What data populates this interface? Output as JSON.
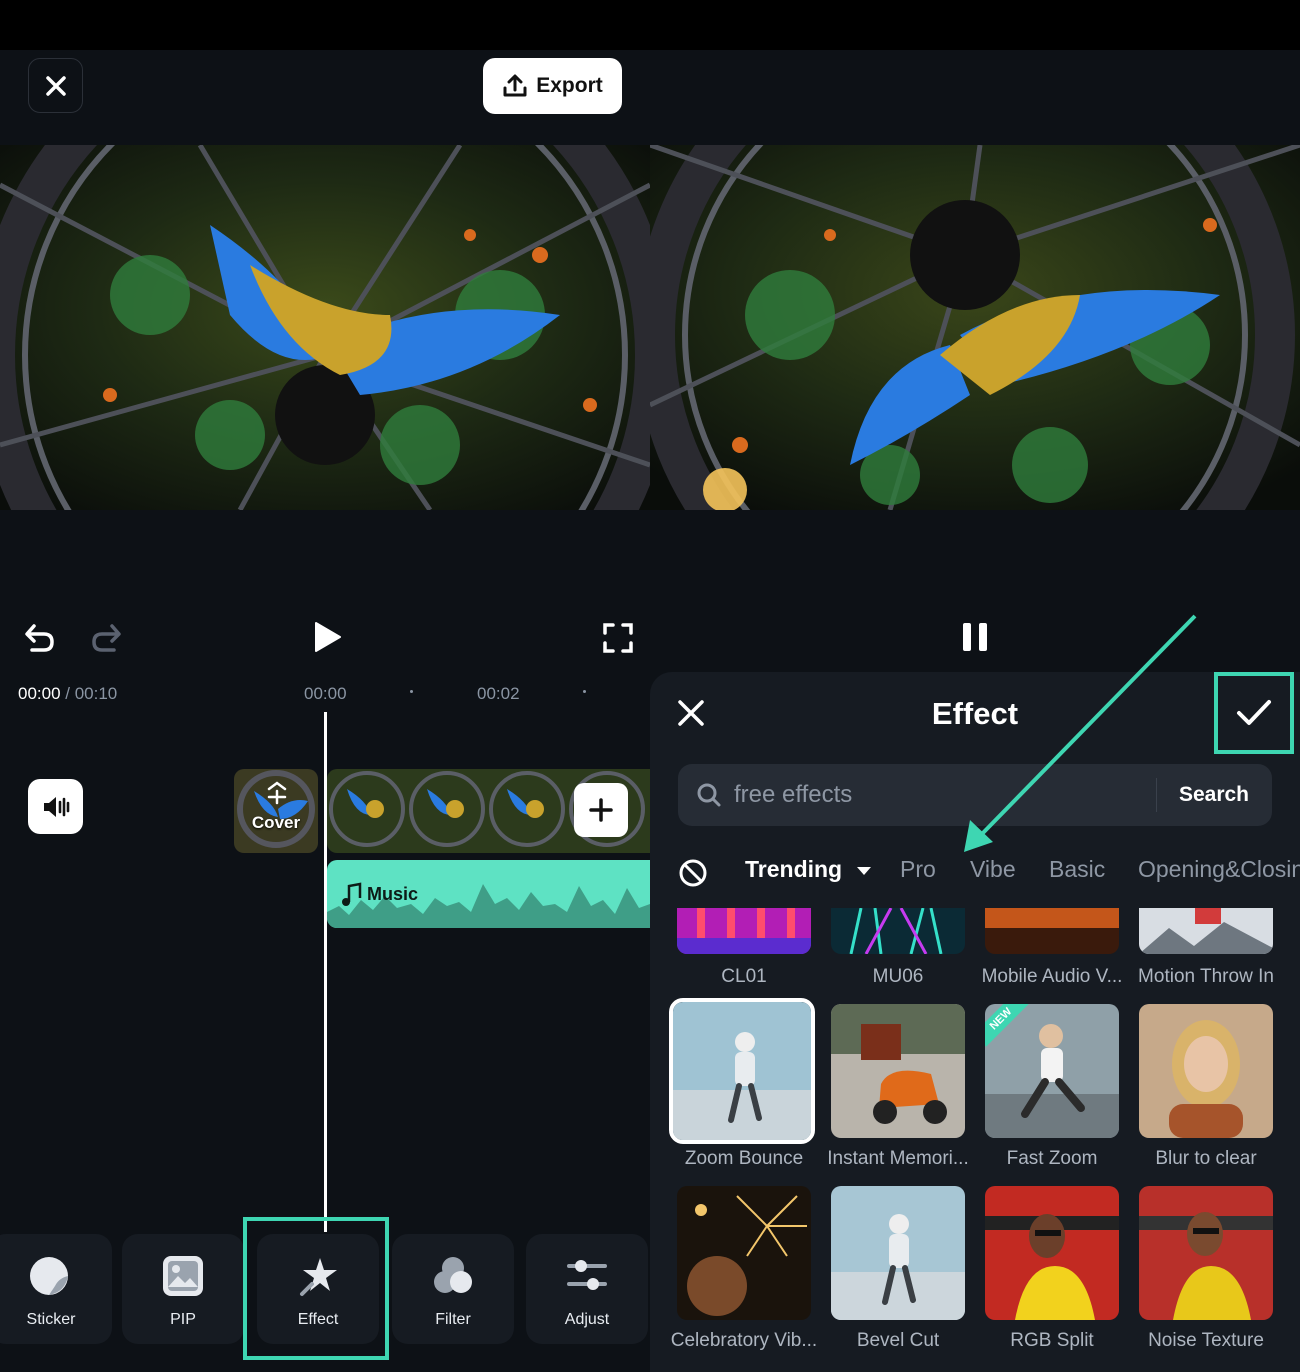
{
  "editor": {
    "export_label": "Export",
    "time_current": "00:00",
    "time_separator": " / ",
    "time_total": "00:10",
    "ruler_ticks": [
      "00:00",
      "00:02"
    ],
    "cover_label": "Cover",
    "music_label": "Music",
    "toolbar": [
      {
        "id": "sticker",
        "label": "Sticker",
        "icon": "sticker-icon"
      },
      {
        "id": "pip",
        "label": "PIP",
        "icon": "pip-icon"
      },
      {
        "id": "effect",
        "label": "Effect",
        "icon": "effect-icon",
        "highlighted": true
      },
      {
        "id": "filter",
        "label": "Filter",
        "icon": "filter-icon"
      },
      {
        "id": "adjust",
        "label": "Adjust",
        "icon": "adjust-icon"
      }
    ]
  },
  "effect_panel": {
    "title": "Effect",
    "search": {
      "placeholder": "free effects",
      "button_label": "Search"
    },
    "tabs": [
      {
        "label": "Trending",
        "active": true
      },
      {
        "label": "Pro"
      },
      {
        "label": "Vibe"
      },
      {
        "label": "Basic"
      },
      {
        "label": "Opening&Closing"
      }
    ],
    "effects": [
      {
        "label": "CL01"
      },
      {
        "label": "MU06"
      },
      {
        "label": "Mobile Audio V..."
      },
      {
        "label": "Motion Throw In"
      },
      {
        "label": "Zoom Bounce",
        "selected": true
      },
      {
        "label": "Instant Memori..."
      },
      {
        "label": "Fast Zoom",
        "badge": "NEW"
      },
      {
        "label": "Blur to clear"
      },
      {
        "label": "Celebratory Vib..."
      },
      {
        "label": "Bevel Cut"
      },
      {
        "label": "RGB Split"
      },
      {
        "label": "Noise Texture"
      }
    ]
  },
  "colors": {
    "accent": "#3ed6b2",
    "background": "#0d1116",
    "panel": "#161b22",
    "music_track": "#5ee2c3"
  }
}
